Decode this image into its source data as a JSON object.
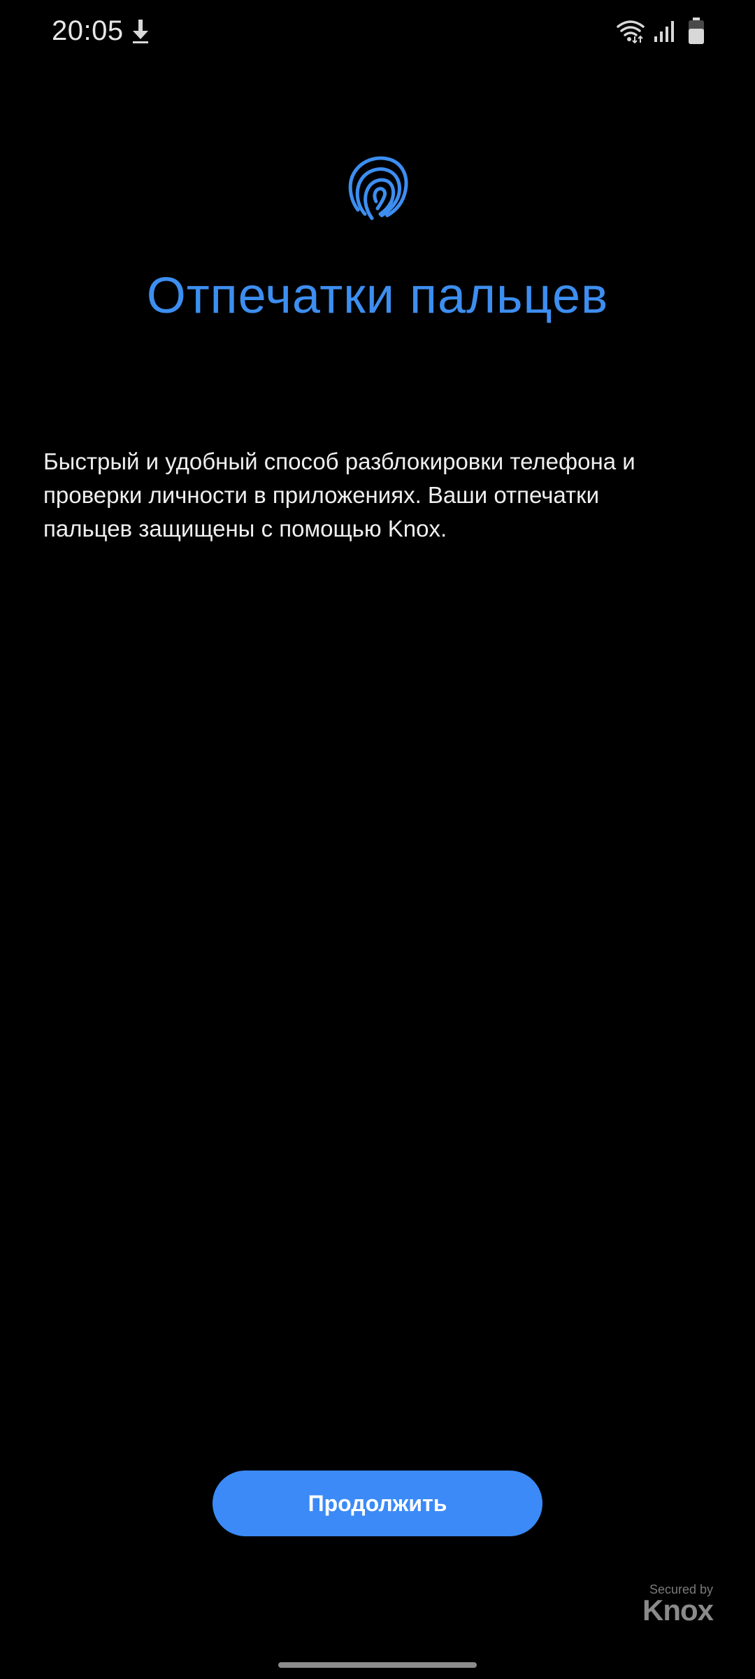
{
  "status_bar": {
    "time": "20:05",
    "icons": [
      "download-icon",
      "wifi-icon",
      "signal-icon",
      "battery-icon"
    ]
  },
  "header": {
    "icon": "fingerprint-icon",
    "title": "Отпечатки пальцев"
  },
  "body": {
    "description": "Быстрый и удобный способ разблокировки телефона и проверки личности в приложениях. Ваши отпечатки пальцев защищены с помощью Knox."
  },
  "actions": {
    "continue_label": "Продолжить"
  },
  "knox_badge": {
    "secured_by": "Secured by",
    "brand": "Knox"
  },
  "colors": {
    "background": "#000000",
    "accent": "#3d8ef0",
    "button": "#3b8af7",
    "text": "#efefef"
  }
}
